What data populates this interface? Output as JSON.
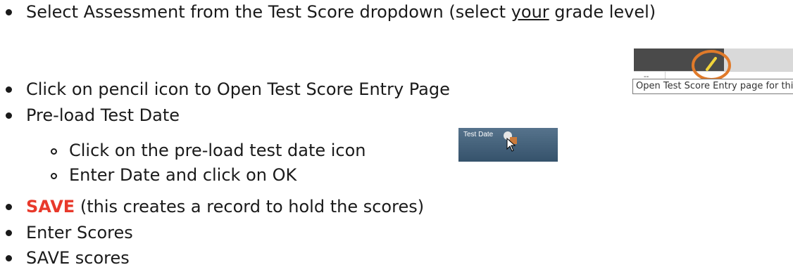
{
  "lines": [
    {
      "pre": "Select Assessment from the Test Score dropdown (select ",
      "underlined": "your",
      "post": " grade level)"
    },
    {
      "text": "Click on pencil icon to Open Test Score Entry Page"
    },
    {
      "text": "Pre-load Test Date"
    },
    {
      "sub": [
        {
          "text": "Click on the pre-load test date icon"
        },
        {
          "text": "Enter Date and click on OK"
        }
      ]
    },
    {
      "save": "SAVE",
      "post": " (this creates a record to hold the scores)"
    },
    {
      "text": "Enter Scores"
    },
    {
      "text": "SAVE scores"
    }
  ],
  "snippet": {
    "dash": "--",
    "tooltip": "Open Test Score Entry page for this"
  },
  "test_date_button": "Test Date",
  "colors": {
    "accent": "#e8392b",
    "circle": "#e07a2a",
    "header_dark": "#4a4a4a",
    "button_blue": "#3d5a74"
  }
}
